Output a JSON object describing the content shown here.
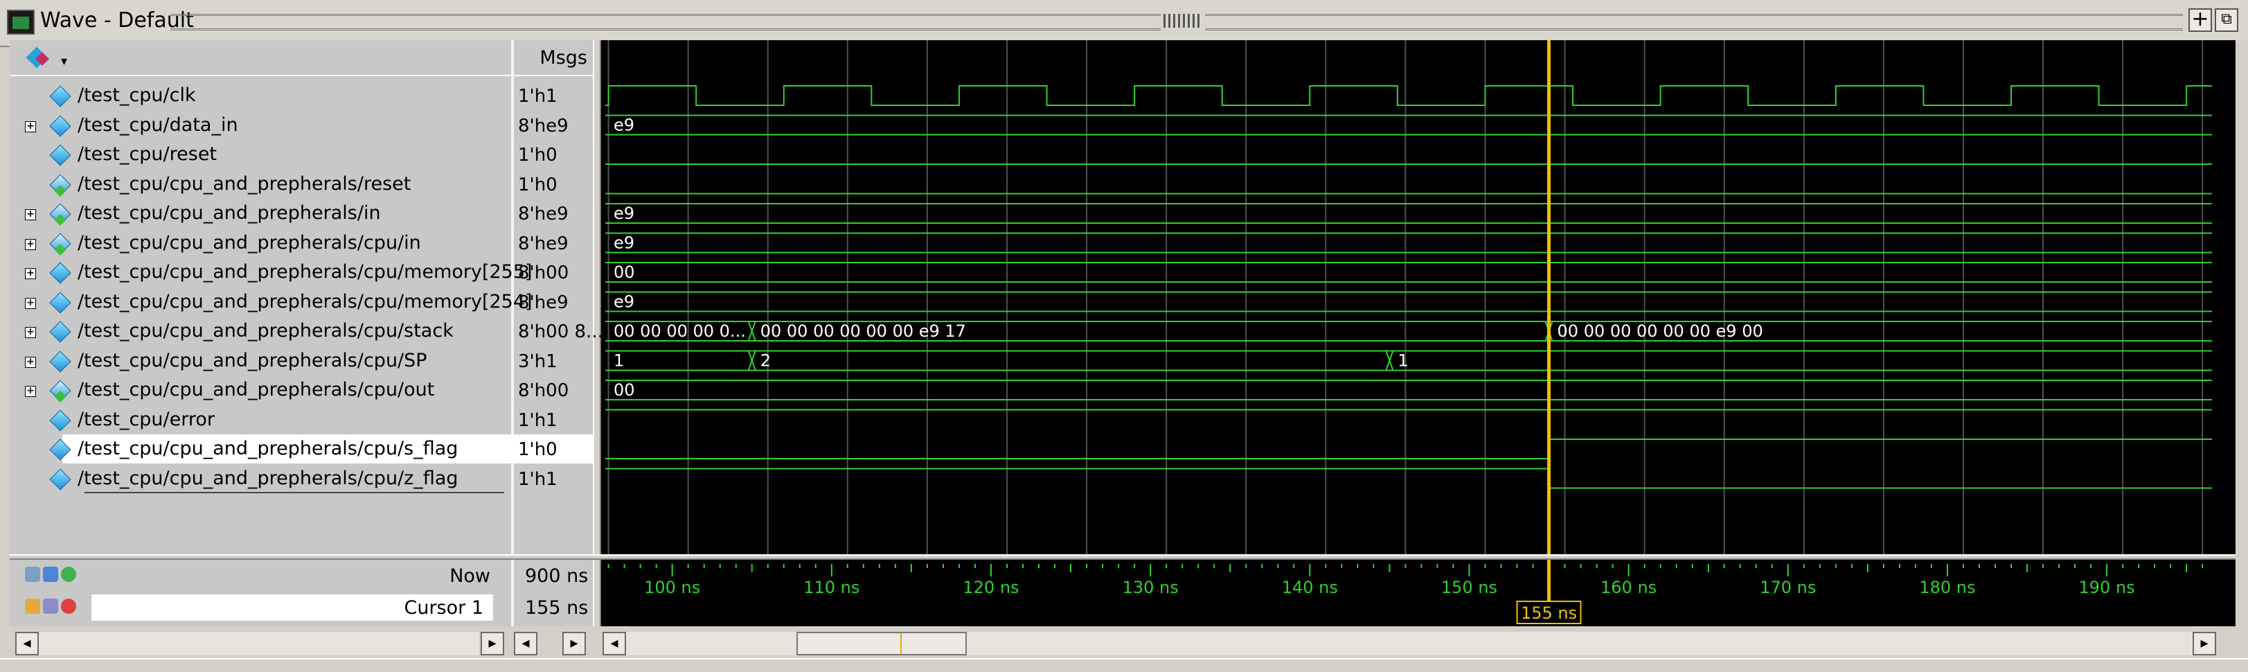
{
  "window": {
    "title": "Wave - Default"
  },
  "headers": {
    "msgs": "Msgs"
  },
  "signals": [
    {
      "name": "/test_cpu/clk",
      "value": "1'h1",
      "expandable": false,
      "icon": "signal-diamond-icon"
    },
    {
      "name": "/test_cpu/data_in",
      "value": "8'he9",
      "expandable": true,
      "icon": "signal-diamond-icon"
    },
    {
      "name": "/test_cpu/reset",
      "value": "1'h0",
      "expandable": false,
      "icon": "signal-diamond-icon"
    },
    {
      "name": "/test_cpu/cpu_and_prepherals/reset",
      "value": "1'h0",
      "expandable": false,
      "icon": "input-signal-icon"
    },
    {
      "name": "/test_cpu/cpu_and_prepherals/in",
      "value": "8'he9",
      "expandable": true,
      "icon": "input-signal-icon"
    },
    {
      "name": "/test_cpu/cpu_and_prepherals/cpu/in",
      "value": "8'he9",
      "expandable": true,
      "icon": "input-signal-icon"
    },
    {
      "name": "/test_cpu/cpu_and_prepherals/cpu/memory[255]",
      "value": "8'h00",
      "expandable": true,
      "icon": "signal-diamond-icon"
    },
    {
      "name": "/test_cpu/cpu_and_prepherals/cpu/memory[254]",
      "value": "8'he9",
      "expandable": true,
      "icon": "signal-diamond-icon"
    },
    {
      "name": "/test_cpu/cpu_and_prepherals/cpu/stack",
      "value": "8'h00 8...",
      "expandable": true,
      "icon": "signal-diamond-icon"
    },
    {
      "name": "/test_cpu/cpu_and_prepherals/cpu/SP",
      "value": "3'h1",
      "expandable": true,
      "icon": "signal-diamond-icon"
    },
    {
      "name": "/test_cpu/cpu_and_prepherals/cpu/out",
      "value": "8'h00",
      "expandable": true,
      "icon": "output-signal-icon"
    },
    {
      "name": "/test_cpu/error",
      "value": "1'h1",
      "expandable": false,
      "icon": "signal-diamond-icon"
    },
    {
      "name": "/test_cpu/cpu_and_prepherals/cpu/s_flag",
      "value": "1'h0",
      "expandable": false,
      "icon": "signal-diamond-icon",
      "selected": true
    },
    {
      "name": "/test_cpu/cpu_and_prepherals/cpu/z_flag",
      "value": "1'h1",
      "expandable": false,
      "icon": "signal-diamond-icon"
    }
  ],
  "waves": {
    "time_start_ns": 95.8,
    "time_end_ns": 196.6,
    "clk_half_period_ns": 2.5,
    "clk_first_rise_ns": 96.0,
    "bus_labels": [
      {
        "row": 1,
        "segments": [
          {
            "from": 95.8,
            "label": "e9"
          }
        ]
      },
      {
        "row": 4,
        "segments": [
          {
            "from": 95.8,
            "label": "e9"
          }
        ]
      },
      {
        "row": 5,
        "segments": [
          {
            "from": 95.8,
            "label": "e9"
          }
        ]
      },
      {
        "row": 6,
        "segments": [
          {
            "from": 95.8,
            "label": "00"
          }
        ]
      },
      {
        "row": 7,
        "segments": [
          {
            "from": 95.8,
            "label": "e9"
          }
        ]
      },
      {
        "row": 8,
        "segments": [
          {
            "from": 95.8,
            "label": "00 00 00 00 0..."
          },
          {
            "from": 105.0,
            "label": "00 00 00 00 00 00 e9 17"
          },
          {
            "from": 155.0,
            "label": "00 00 00 00 00 00 e9 00"
          }
        ]
      },
      {
        "row": 9,
        "segments": [
          {
            "from": 95.8,
            "label": "1"
          },
          {
            "from": 105.0,
            "label": "2"
          },
          {
            "from": 145.0,
            "label": "1"
          }
        ]
      },
      {
        "row": 10,
        "segments": [
          {
            "from": 95.8,
            "label": "00"
          }
        ]
      }
    ],
    "flat_rows": [
      {
        "row": 2,
        "level": 0
      },
      {
        "row": 3,
        "level": 0
      },
      {
        "row": 11,
        "level": 1
      },
      {
        "row": 12,
        "level": 0,
        "change_at": 155.0,
        "new_level": 1
      },
      {
        "row": 13,
        "level": 1,
        "change_at": 155.0,
        "new_level": 0
      }
    ]
  },
  "timeline": {
    "ticks": [
      {
        "t": 100,
        "label": "100 ns"
      },
      {
        "t": 110,
        "label": "110 ns"
      },
      {
        "t": 120,
        "label": "120 ns"
      },
      {
        "t": 130,
        "label": "130 ns"
      },
      {
        "t": 140,
        "label": "140 ns"
      },
      {
        "t": 150,
        "label": "150 ns"
      },
      {
        "t": 160,
        "label": "160 ns"
      },
      {
        "t": 170,
        "label": "170 ns"
      },
      {
        "t": 180,
        "label": "180 ns"
      },
      {
        "t": 190,
        "label": "190 ns"
      }
    ]
  },
  "cursor": {
    "time_ns": 155,
    "label": "155 ns",
    "name": "Cursor 1",
    "value": "155 ns"
  },
  "now": {
    "label": "Now",
    "value": "900 ns"
  },
  "colors": {
    "wave": "#2fd12f",
    "cursor": "#f0c000",
    "grid": "#505050",
    "bg": "#000000",
    "tick_text": "#2fd12f"
  }
}
